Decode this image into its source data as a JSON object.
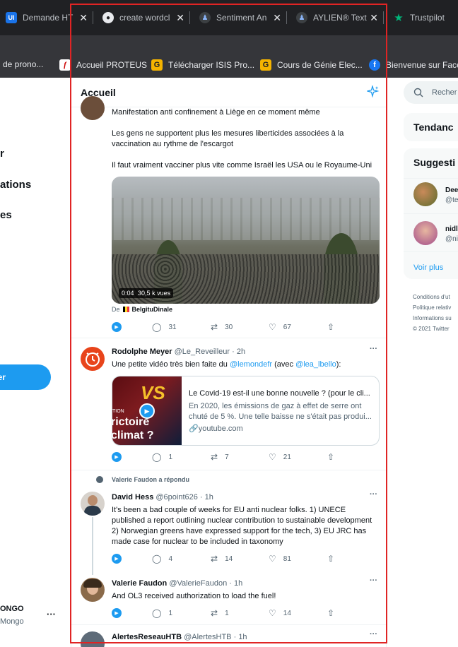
{
  "tabs": [
    {
      "title": "Demande HT",
      "favicon": "ui-icon"
    },
    {
      "title": "create wordcl",
      "favicon": "globe-icon"
    },
    {
      "title": "Sentiment An",
      "favicon": "aylien-icon"
    },
    {
      "title": "AYLIEN® Text",
      "favicon": "aylien-icon"
    },
    {
      "title": "Trustpilot",
      "favicon": "star-icon"
    }
  ],
  "bookmarks": [
    {
      "label": "de prono...",
      "icon": ""
    },
    {
      "label": "Accueil PROTEUS",
      "icon": "f"
    },
    {
      "label": "Télécharger ISIS Pro...",
      "icon": "G"
    },
    {
      "label": "Cours de Génie Elec...",
      "icon": "G"
    },
    {
      "label": "Bienvenue sur Facel",
      "icon": "f"
    }
  ],
  "left_nav": [
    "r",
    "ations",
    "es"
  ],
  "tweet_button": "er",
  "account": {
    "name": "ONGO",
    "handle": "Mongo",
    "more": "···"
  },
  "header": {
    "title": "Accueil"
  },
  "tweets": [
    {
      "paragraphs": [
        "Manifestation anti confinement à Liège en ce moment même",
        "Les gens ne supportent plus les mesures liberticides associées à la vaccination au rythme de l'escargot",
        "Il faut vraiment vacciner plus vite comme Israël les USA ou le Royaume-Uni"
      ],
      "video": {
        "time": "0:04",
        "views": "30,5 k vues"
      },
      "from_prefix": "De",
      "from_name": "BelgituDinale",
      "actions": {
        "replies": "31",
        "retweets": "30",
        "likes": "67"
      }
    },
    {
      "name": "Rodolphe Meyer",
      "handle": "@Le_Reveilleur",
      "time": "2h",
      "more": "···",
      "text_before": "Une petite vidéo très bien faite du ",
      "mention1": "@lemondefr",
      "text_mid": " (avec ",
      "mention2": "@lea_lbello",
      "text_after": "):",
      "card": {
        "thumb_text1": "VS",
        "thumb_text2": "rictoire",
        "thumb_text3": "climat ?",
        "thumb_tag": "TION",
        "title": "Le Covid-19 est-il une bonne nouvelle ? (pour le cli...",
        "desc": "En 2020, les émissions de gaz à effet de serre ont chuté de 5 %. Une telle baisse ne s'était pas produi...",
        "domain": "youtube.com"
      },
      "actions": {
        "replies": "1",
        "retweets": "7",
        "likes": "21"
      }
    },
    {
      "context": "Valerie Faudon a répondu",
      "name": "David Hess",
      "handle": "@6point626",
      "time": "1h",
      "more": "···",
      "text": "It's been a bad couple of weeks for EU anti nuclear folks. 1) UNECE published a report outlining nuclear contribution to sustainable development 2) Norwegian greens have expressed support for the tech, 3) EU JRC has made case for nuclear to be included in taxonomy",
      "actions": {
        "replies": "4",
        "retweets": "14",
        "likes": "81"
      }
    },
    {
      "name": "Valerie Faudon",
      "handle": "@ValerieFaudon",
      "time": "1h",
      "more": "···",
      "text": "And OL3 received authorization to load the fuel!",
      "actions": {
        "replies": "1",
        "retweets": "1",
        "likes": "14"
      }
    },
    {
      "name": "AlertesReseauHTB",
      "handle": "@AlertesHTB",
      "time": "1h",
      "more": "···"
    }
  ],
  "right": {
    "search_placeholder": "Recher",
    "trends_title": "Tendanc",
    "suggestions_title": "Suggesti",
    "suggestions": [
      {
        "name": "Dee",
        "handle": "@te"
      },
      {
        "name": "nidl",
        "handle": "@ni"
      }
    ],
    "see_more": "Voir plus",
    "footer": [
      "Conditions d'ut",
      "Politique relativ",
      "Informations su",
      "© 2021 Twitter"
    ]
  },
  "colors": {
    "accent": "#1d9bf0",
    "tab_bg": "#202124",
    "bookmark_bg": "#35363a",
    "highlight": "#e02424"
  }
}
